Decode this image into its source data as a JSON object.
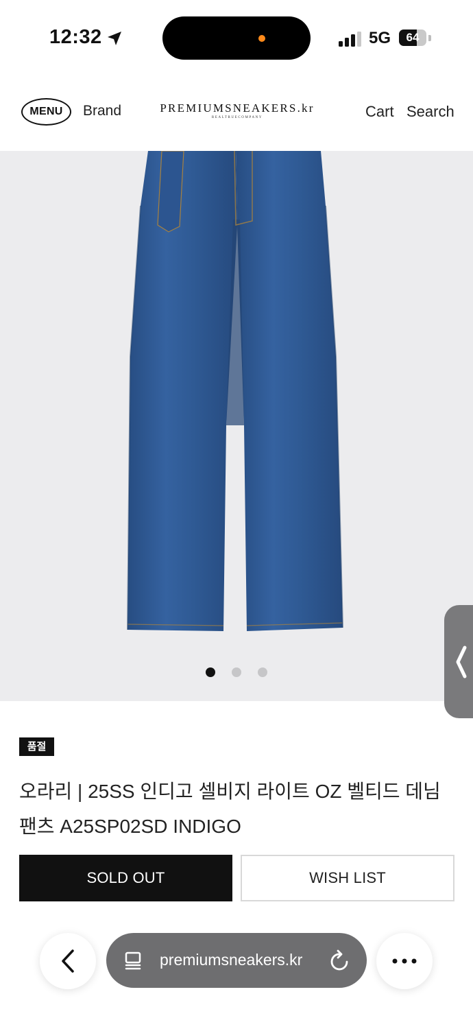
{
  "status_bar": {
    "time": "12:32",
    "network": "5G",
    "battery": "64",
    "battery_level": 0.64
  },
  "header": {
    "menu_label": "MENU",
    "brand_label": "Brand",
    "logo_text": "PREMIUMSNEAKERS.kr",
    "logo_sub": "REALTRUECOMPANY",
    "cart_label": "Cart",
    "search_label": "Search"
  },
  "gallery": {
    "image_alt": "jeans-image",
    "dots": 3,
    "active_index": 0
  },
  "product": {
    "badge": "품절",
    "title": "오라리 | 25SS 인디고 셀비지 라이트 OZ 벨티드 데님 팬츠 A25SP02SD INDIGO",
    "sold_out_label": "SOLD OUT",
    "wishlist_label": "WISH LIST"
  },
  "browser": {
    "url": "premiumsneakers.kr"
  },
  "colors": {
    "denim": "#2f5a94",
    "denim_dark": "#26497a",
    "background": "#ececee",
    "orange_indicator": "#ff8a1a"
  }
}
